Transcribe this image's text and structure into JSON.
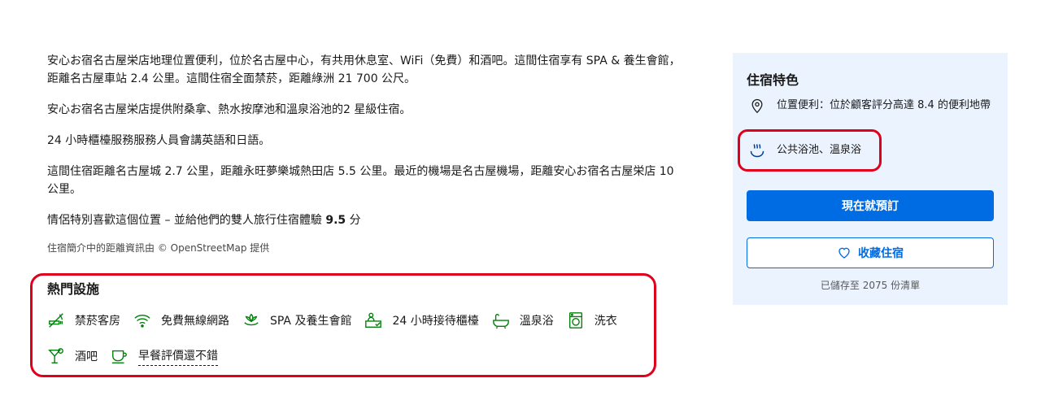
{
  "description": {
    "paragraphs": [
      "安心お宿名古屋栄店地理位置便利，位於名古屋中心，有共用休息室、WiFi（免費）和酒吧。這間住宿享有 SPA & 養生會館，距離名古屋車站 2.4 公里。這間住宿全面禁菸，距離綠洲 21 700 公尺。",
      "安心お宿名古屋栄店提供附桑拿、熱水按摩池和溫泉浴池的2 星級住宿。",
      "24 小時櫃檯服務服務人員會講英語和日語。",
      "這間住宿距離名古屋城 2.7 公里，距離永旺夢樂城熱田店 5.5 公里。最近的機場是名古屋機場，距離安心お宿名古屋栄店 10 公里。"
    ],
    "couples_text": "情侶特別喜歡這個位置 – 並給他們的雙人旅行住宿體驗",
    "couples_score": "9.5",
    "couples_unit": "分",
    "osm_credit": "住宿簡介中的距離資訊由 © OpenStreetMap 提供"
  },
  "facilities": {
    "title": "熱門設施",
    "row1": [
      {
        "label": "禁菸客房",
        "icon": "no-smoking-icon"
      },
      {
        "label": "免費無線網路",
        "icon": "wifi-icon"
      },
      {
        "label": "SPA 及養生會館",
        "icon": "spa-icon"
      },
      {
        "label": "24 小時接待櫃檯",
        "icon": "front-desk-icon"
      },
      {
        "label": "溫泉浴",
        "icon": "hot-spring-bath-icon"
      },
      {
        "label": "洗衣",
        "icon": "laundry-icon"
      }
    ],
    "row2": [
      {
        "label": "酒吧",
        "icon": "cocktail-icon"
      },
      {
        "label": "早餐評價還不錯",
        "icon": "coffee-cup-icon"
      }
    ]
  },
  "highlights": {
    "title": "住宿特色",
    "location": "位置便利：位於顧客評分高達 8.4 的便利地帶",
    "onsen": "公共浴池、溫泉浴",
    "reserve_label": "現在就預訂",
    "save_label": "收藏住宿",
    "saved_count": "已儲存至 2075 份清單"
  },
  "colors": {
    "facility_icon": "#008009",
    "primary": "#006ce4",
    "sidebar_bg": "#ebf3ff",
    "highlight_box": "#e0001b"
  }
}
